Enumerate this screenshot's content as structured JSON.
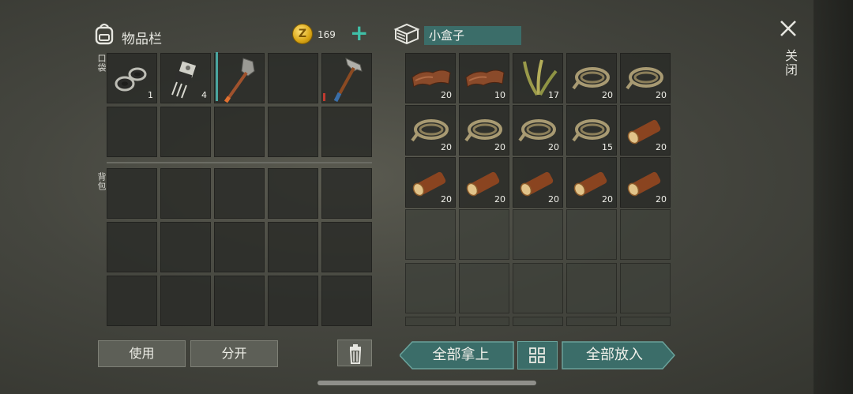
{
  "inventory": {
    "title": "物品栏",
    "gold": "169",
    "pocket_label": "口袋",
    "backpack_label": "背包",
    "pocket_items": [
      {
        "name": "washers",
        "count": "1"
      },
      {
        "name": "transistor",
        "count": "4"
      },
      {
        "name": "shovel",
        "count": ""
      },
      {
        "name": "empty",
        "count": ""
      },
      {
        "name": "hammer",
        "count": ""
      }
    ]
  },
  "container": {
    "title": "小盒子",
    "items": [
      {
        "name": "leather",
        "count": "20"
      },
      {
        "name": "leather",
        "count": "10"
      },
      {
        "name": "plant-fiber",
        "count": "17"
      },
      {
        "name": "rope",
        "count": "20"
      },
      {
        "name": "rope",
        "count": "20"
      },
      {
        "name": "rope",
        "count": "20"
      },
      {
        "name": "rope",
        "count": "20"
      },
      {
        "name": "rope",
        "count": "20"
      },
      {
        "name": "rope",
        "count": "15"
      },
      {
        "name": "log",
        "count": "20"
      },
      {
        "name": "log",
        "count": "20"
      },
      {
        "name": "log",
        "count": "20"
      },
      {
        "name": "log",
        "count": "20"
      },
      {
        "name": "log",
        "count": "20"
      },
      {
        "name": "log",
        "count": "20"
      }
    ]
  },
  "buttons": {
    "use": "使用",
    "split": "分开",
    "take_all": "全部拿上",
    "put_all": "全部放入",
    "close": "关闭"
  },
  "icons": {
    "backpack": "backpack-icon",
    "gold": "coin-icon",
    "add": "plus-icon",
    "box": "box-icon",
    "trash": "trash-icon",
    "sort": "grid-icon",
    "close": "close-icon"
  },
  "colors": {
    "accent_teal": "#3b6d69",
    "plus_green": "#3fc0a8",
    "coin_gold": "#d9a514"
  }
}
